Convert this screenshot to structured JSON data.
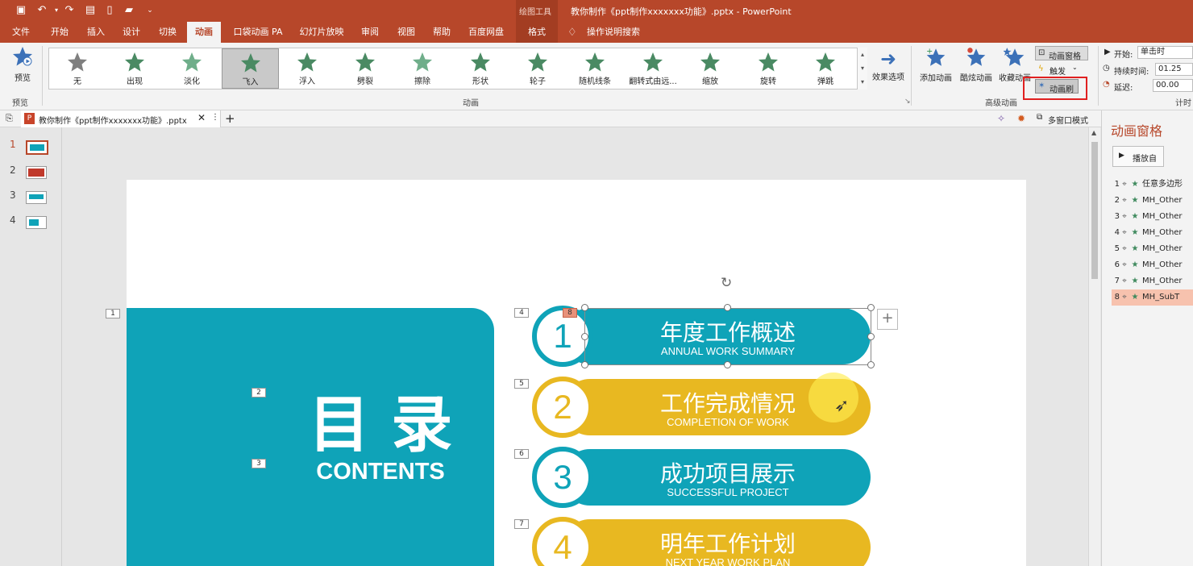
{
  "titlebar": {
    "context_tools": "绘图工具",
    "doc_title": "教你制作《ppt制作xxxxxxx功能》.pptx  -  PowerPoint"
  },
  "tabs": [
    {
      "label": "文件"
    },
    {
      "label": "开始"
    },
    {
      "label": "插入"
    },
    {
      "label": "设计"
    },
    {
      "label": "切换"
    },
    {
      "label": "动画"
    },
    {
      "label": "口袋动画 PA"
    },
    {
      "label": "幻灯片放映"
    },
    {
      "label": "审阅"
    },
    {
      "label": "视图"
    },
    {
      "label": "帮助"
    },
    {
      "label": "百度网盘"
    },
    {
      "label": "格式"
    },
    {
      "label": "操作说明搜索"
    }
  ],
  "ribbon": {
    "preview": {
      "label": "预览",
      "group": "预览"
    },
    "gallery_items": [
      {
        "label": "无",
        "color": "#7f7f7f"
      },
      {
        "label": "出现",
        "color": "#4a8a63"
      },
      {
        "label": "淡化",
        "color": "#6fae8a"
      },
      {
        "label": "飞入",
        "color": "#4a8a63"
      },
      {
        "label": "浮入",
        "color": "#4a8a63"
      },
      {
        "label": "劈裂",
        "color": "#4a8a63"
      },
      {
        "label": "擦除",
        "color": "#6fae8a"
      },
      {
        "label": "形状",
        "color": "#4a8a63"
      },
      {
        "label": "轮子",
        "color": "#4a8a63"
      },
      {
        "label": "随机线条",
        "color": "#4a8a63"
      },
      {
        "label": "翻转式由远...",
        "color": "#4a8a63"
      },
      {
        "label": "缩放",
        "color": "#4a8a63"
      },
      {
        "label": "旋转",
        "color": "#4a8a63"
      },
      {
        "label": "弹跳",
        "color": "#4a8a63"
      }
    ],
    "group_animation": "动画",
    "effect_options": "效果选项",
    "add_animation": "添加动画",
    "cool_animation": "酷炫动画",
    "fav_animation": "收藏动画",
    "anim_pane_btn": "动画窗格",
    "trigger": "触发",
    "anim_painter": "动画刷",
    "group_advanced": "高级动画",
    "start_label": "开始:",
    "start_value": "单击时",
    "duration_label": "持续时间:",
    "duration_value": "01.25",
    "delay_label": "延迟:",
    "delay_value": "00.00",
    "group_timing": "计时"
  },
  "docbar": {
    "tab_title": "教你制作《ppt制作xxxxxxx功能》.pptx",
    "multi_window": "多窗口模式"
  },
  "thumbnails": [
    "1",
    "2",
    "3",
    "4"
  ],
  "slide": {
    "badges": [
      "1",
      "2",
      "3",
      "4",
      "5",
      "6",
      "7",
      "8"
    ],
    "title_cn": "目 录",
    "title_en": "CONTENTS",
    "items": [
      {
        "num": "1",
        "title": "年度工作概述",
        "sub": "ANNUAL WORK SUMMARY",
        "color": "#0fa3b8"
      },
      {
        "num": "2",
        "title": "工作完成情况",
        "sub": "COMPLETION OF WORK",
        "color": "#e8b821"
      },
      {
        "num": "3",
        "title": "成功项目展示",
        "sub": "SUCCESSFUL PROJECT",
        "color": "#0fa3b8"
      },
      {
        "num": "4",
        "title": "明年工作计划",
        "sub": "NEXT YEAR WORK PLAN",
        "color": "#e8b821"
      }
    ]
  },
  "anim_pane": {
    "title": "动画窗格",
    "play_from": "播放自",
    "rows": [
      {
        "num": "1",
        "name": "任意多边形"
      },
      {
        "num": "2",
        "name": "MH_Other"
      },
      {
        "num": "3",
        "name": "MH_Other"
      },
      {
        "num": "4",
        "name": "MH_Other"
      },
      {
        "num": "5",
        "name": "MH_Other"
      },
      {
        "num": "6",
        "name": "MH_Other"
      },
      {
        "num": "7",
        "name": "MH_Other"
      },
      {
        "num": "8",
        "name": "MH_SubT"
      }
    ]
  },
  "colors": {
    "accent": "#b7472a",
    "teal": "#0fa3b8",
    "gold": "#e8b821",
    "highlight_box": "#e02020"
  }
}
